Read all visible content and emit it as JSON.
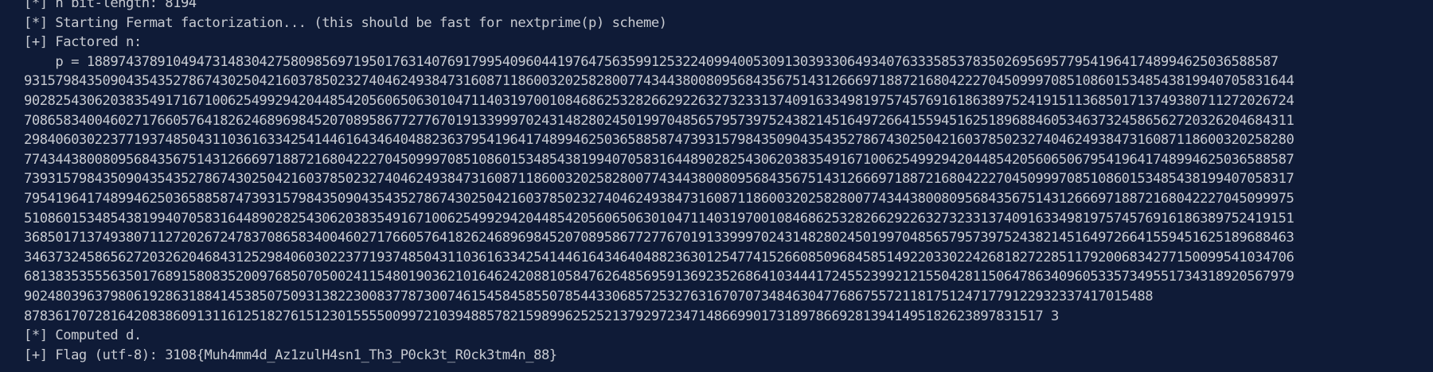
{
  "terminal": {
    "lines": [
      "[*] n bit-length: 8194",
      "[*] Starting Fermat factorization... (this should be fast for nextprime(p) scheme)",
      "[+] Factored n:",
      "p = 18897437891049473148304275809856971950176314076917995409604419764756359912532240994005309130393306493407633358537835026956957795419641748994625036588587473931579843509043543527867430250421603785023274046249384731608711860032025828007743443800809568435675143126669718872168042227045099970851086015348543819940705831644890282543062038354917167100625499294204485420560650630104711403197001084686253282662922632732331374091633498197574576916186389752419151136850171374938071127202672478370865834004602717660576418262468969845207089586772776701913399970243148280245019970485657957397524382145164972664155945162518968846053463732458656272032620468431298406030223771937485043110361633425414461643464048823637954196417489946250365885874739315798435090435435278674302504216037850232740462493847316087118600320258280077434438008095684356751431266697188721680422270450999708510860153485438199407058316448902825430620383549167100625499294204485420560650679541964174899462503658858739315798435090435435278674302504216037850232740462493847316087118600320258280077434438008095684356751431266697188721680422270450999708510860153485438199407058317954196417489946250365885874739315798435090435435278674302504216037850232740462493847316087118600320258280077434438008095684356751431266697188721680422270450999975108601534854381994070583164489028254306203835491671006254992942044854205606506301047114031970010846862532826629226327323313740916334981975745769161863897524191536850171374938071127202672478370865834004602717660576418262468969845207089586772776701913399970243148280245019970485657957397524382145164972664155945162518968846346373245865627203262046843125298406030223771937485043110361633425414461643464048823630125477415266085096845851492203302242681827228511792006834277150099541034706813835355563501768915808352009768507050024115480190362101646242088105847626485695913692352686410344417245523992121550428115064786340960533573495517343189205679790248039637980619286318841453850750931382230083778730074615458458550785443306857253276316707073484630477686755721181751247177912293233741701548878361707281642083860913116125182761512301555500997210394885782159899625252137929723471486699017318978669281394149518262389783151 73"
    ],
    "line4_rows": [
      "p = 188974378910494731483042758098569719501763140769179954096044197647563599125322409940053091303933064934076333585378350269569577954196417489946250365885874",
      "9315798435090435435278674302504216037850232740462493847316087118600320258280077434438008095684356751431266697188721680422270450999708510860153485438199407058316",
      "44890282543062038354917167100625499294204485420560650630104711403197001084686253282662922632732331374091633498197574576916186389752419151136850171374938071127202672478370865834004602717660576418262468969845207089586772776701913399970243148280245019970485657957397524382145164972664155945162518968846053463732458656272032620468431",
      "2984060302237719374850431103616334254144616434640488236379541964174899462503658858747393157984350904354352786743025042160378502327404624938473160871186003202582800774344380080956843567514312666971887216804222704509997085108601534854381994070583164489028254306203835491671006254992942044854205606506795419641748994625036588587",
      "4739315798435090435435278674302504216037850232740462493847316087118600320258280077434438008095684356751431266697188721680422270450999708510860153485438199407058317"
    ],
    "rows": [
      "[*] n bit-length: 8194",
      "[*] Starting Fermat factorization... (this should be fast for nextprime(p) scheme)",
      "[+] Factored n:",
      "    p = 188974378910494731483042758098569719501763140769179954096044197647563599125322409940053091303933064934076333585378350269569577954196417489946250365885874",
      "93157984350904354352786743025042160378502327404624938473160871186003202582800774344380080956843567514312666971887216804222704509997085108601534854381994070583164",
      "90282543062038354917167100625499294204485420560650630104711403197001084686253282662922632732331374091633498197574576916186389752419151136850171374938071127202672478",
      "70865834004602717660576418262468969845207089586772776701913399970243148280245019970485657957397524382145164972664155945162518968846053463732458656272032620468431",
      "29840603022377193748504311036163342541446164346404882363795419641748994625036588587473931579843509043543527867430250421603785023274046249384731608711860032025828",
      "77434438008095684356751431266697188721680422270450999708510860153485438199407058316448902825430620383549167100625499294204485420560650679541964174899462503658858",
      "73931579843509043543527867430250421603785023274046249384731608711860032025828007743443800809568435675143126669718872168042227045099970851086015348543819940705831",
      "79541964174899462503658858747393157984350904354352786743025042160378502327404624938473160871186003202582800774344380080956843567514312666971887216804222704509997",
      "51086015348543819940705831644890282543062038354917167100625499294204485420560650630104711403197001084686253282662922632732331374091633498197574576916186389752419151",
      "36850171374938071127202672478370865834004602717660576418262468969845207089586772776701913399970243148280245019970485657957397524382145164972664155945162518968846",
      "34637324586562720326204684312529840603022377193748504311036163342541446164346404882363012547741526608509684585149220330224268182722851179200683427715009954103470",
      "68138353556350176891580835200976850705002411548019036210164624208810584762648569591369235268641034441724552399212155042811506478634096053357349551734318920567970",
      "90248039637980619286318841453850750931382230083778730074615458458550785443306857253276316707073484630477686755721181751247177912293233741701548",
      "8783617072816420838609131161251827615123015555009972103948857821598996252521379297234714866990173189786692813941495182623897831517 3"
    ],
    "tail_lines": [
      "[*] Computed d.",
      "[+] Flag (utf-8): 3108{Muh4mm4d_Az1zulH4sn1_Th3_P0ck3t_R0ck3tm4n_88}"
    ]
  },
  "display": {
    "l0": "[*] n bit-length: 8194",
    "l1": "[*] Starting Fermat factorization... (this should be fast for nextprime(p) scheme)",
    "l2": "[+] Factored n:",
    "l3": "    p = 18897437891049473148304275809856971950176314076917995409604419764756359912532240994005309130393306493407633358537835026956957795419641748994625036588587",
    "l4": "931579843509043543527867430250421603785023274046249384731608711860032025828007743443800809568435675143126669718872168042227045099970851086015348543819940705831644",
    "l5": "902825430620383549171671006254992942044854205606506301047114031970010846862532826629226327323313740916334981975745769161863897524191511368501713749380711272026724",
    "l6": "708658340046027176605764182624689698452070895867727767019133999702431482802450199704856579573975243821451649726641559451625189688460534637324586562720326204684311",
    "l7": "298406030223771937485043110361633425414461643464048823637954196417489946250365885874739315798435090435435278674302504216037850232740462493847316087118600320258280",
    "l8": "774344380080956843567514312666971887216804222704509997085108601534854381994070583164489028254306203835491671006254992942044854205606506795419641748994625036588587",
    "l9": "739315798435090435435278674302504216037850232740462493847316087118600320258280077434438008095684356751431266697188721680422270450999708510860153485438199407058317",
    "l10": "795419641748994625036588587473931579843509043543527867430250421603785023274046249384731608711860032025828007743443800809568435675143126669718872168042227045099975",
    "l11": "510860153485438199407058316448902825430620383549167100625499294204485420560650630104711403197001084686253282662922632732331374091633498197574576916186389752419151",
    "l12": "368501713749380711272026724783708658340046027176605764182624689698452070895867727767019133999702431482802450199704856579573975243821451649726641559451625189688463",
    "l13": "346373245865627203262046843125298406030223771937485043110361633425414461643464048823630125477415266085096845851492203302242681827228511792006834277150099541034706",
    "l14": "681383535556350176891580835200976850705002411548019036210164624208810584762648569591369235268641034441724552399212155042811506478634096053357349551734318920567979",
    "l15": "902480396379806192863188414538507509313822300837787300746154584585507854433068572532763167070734846304776867557211817512471779122932337417015488",
    "l16": "8783617072816420838609131161251827615123015555009972103948857821598996252521379297234714866990173189786692813941495182623897831517 3",
    "l17": "[*] Computed d.",
    "l18": "[+] Flag (utf-8): 3108{Muh4mm4d_Az1zulH4sn1_Th3_P0ck3t_R0ck3tm4n_88}"
  }
}
